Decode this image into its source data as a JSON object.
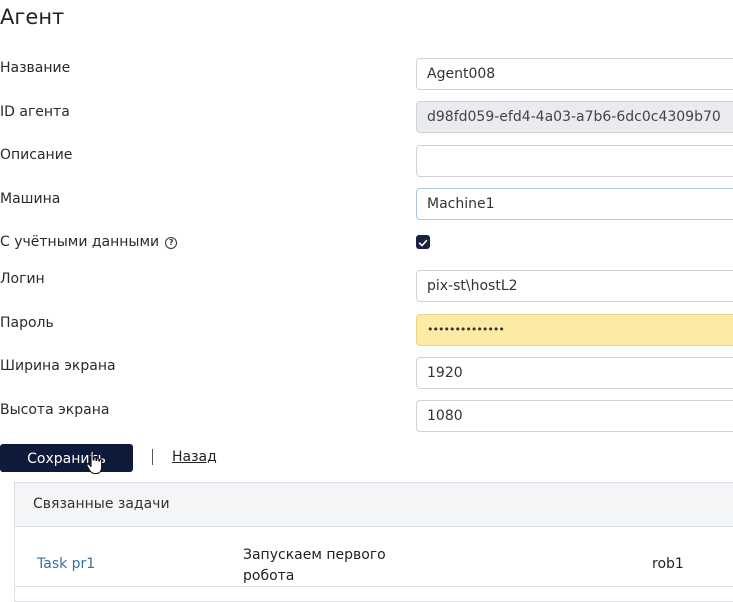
{
  "page": {
    "title": "Агент"
  },
  "form": {
    "name_label": "Название",
    "name_value": "Agent008",
    "id_label": "ID агента",
    "id_value": "d98fd059-efd4-4a03-a7b6-6dc0c4309b70",
    "description_label": "Описание",
    "description_value": "",
    "machine_label": "Машина",
    "machine_value": "Machine1",
    "credentials_label": "С учётными данными",
    "credentials_help_icon": "?",
    "credentials_checked": true,
    "login_label": "Логин",
    "login_value": "pix-st\\hostL2",
    "password_label": "Пароль",
    "password_value": "••••••••••••••",
    "screen_width_label": "Ширина экрана",
    "screen_width_value": "1920",
    "screen_height_label": "Высота экрана",
    "screen_height_value": "1080"
  },
  "actions": {
    "save_label": "Сохранить",
    "back_label": "Назад"
  },
  "related_tasks": {
    "header": "Связанные задачи",
    "rows": [
      {
        "name": "Task pr1",
        "description": "Запускаем первого робота",
        "user": "rob1"
      }
    ]
  },
  "colors": {
    "primary_button": "#0f1a3b",
    "link": "#3a6fa5",
    "autofill": "#fbeba4",
    "readonly": "#e9ebee"
  }
}
